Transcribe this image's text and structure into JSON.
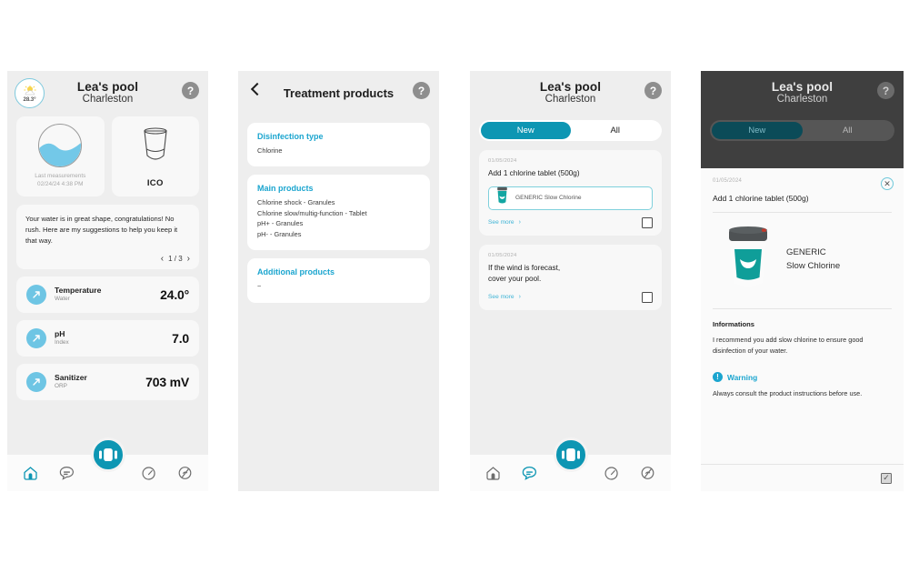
{
  "panel1": {
    "weather": {
      "temp": "28.3°",
      "icon": "sun-cloud-icon"
    },
    "header": {
      "title": "Lea's pool",
      "subtitle": "Charleston",
      "help": "?"
    },
    "tiles": [
      {
        "name": "water-measurements",
        "caption_line1": "Last measurements",
        "caption_line2": "02/24/24 4:38 PM"
      },
      {
        "name": "ico-device",
        "label": "ICO"
      }
    ],
    "advice": {
      "text": "Your water is in great shape, congratulations! No rush. Here are my suggestions to help you keep it that way.",
      "pager": "1 / 3",
      "prev": "‹",
      "next": "›"
    },
    "metrics": [
      {
        "name": "Temperature",
        "sub": "Water",
        "value": "24.0°"
      },
      {
        "name": "pH",
        "sub": "Index",
        "value": "7.0"
      },
      {
        "name": "Sanitizer",
        "sub": "ORP",
        "value": "703 mV"
      }
    ],
    "nav": [
      "home-icon",
      "chat-icon",
      "gauge-icon",
      "maintenance-icon"
    ],
    "active_nav": "home-icon"
  },
  "panel2": {
    "header": {
      "title": "Treatment products",
      "help": "?",
      "back": "back-arrow"
    },
    "sections": [
      {
        "title": "Disinfection type",
        "lines": [
          "Chlorine"
        ]
      },
      {
        "title": "Main products",
        "lines": [
          "Chlorine shock - Granules",
          "Chlorine slow/multig-function - Tablet",
          "pH+ - Granules",
          "pH- - Granules"
        ]
      },
      {
        "title": "Additional products",
        "lines": [
          "~"
        ]
      }
    ]
  },
  "panel3": {
    "header": {
      "title": "Lea's pool",
      "subtitle": "Charleston",
      "help": "?"
    },
    "tabs": [
      {
        "label": "New",
        "active": true
      },
      {
        "label": "All",
        "active": false
      }
    ],
    "messages": [
      {
        "date": "01/05/2024",
        "title": "Add 1 chlorine tablet (500g)",
        "product": "GENERIC Slow Chlorine",
        "see_more": "See more",
        "chevron": "›",
        "has_product": true
      },
      {
        "date": "01/05/2024",
        "title": "If the wind is forecast,\ncover your pool.",
        "see_more": "See more",
        "chevron": "›",
        "has_product": false
      }
    ],
    "nav": [
      "home-icon",
      "chat-icon",
      "gauge-icon",
      "maintenance-icon"
    ],
    "active_nav": "chat-icon"
  },
  "panel4": {
    "header": {
      "title": "Lea's pool",
      "subtitle": "Charleston",
      "help": "?"
    },
    "tabs": [
      {
        "label": "New",
        "active": true
      },
      {
        "label": "All",
        "active": false
      }
    ],
    "sheet": {
      "date": "01/05/2024",
      "title": "Add 1 chlorine tablet (500g)",
      "close": "✕",
      "product_brand": "GENERIC",
      "product_name": "Slow Chlorine",
      "info_heading": "Informations",
      "info_text": "I recommend you add slow chlorine to ensure good disinfection of your water.",
      "warning_badge": "!",
      "warning_title": "Warning",
      "warning_text": "Always consult the product instructions before use.",
      "confirm": "✓"
    }
  },
  "colors": {
    "accent_teal": "#0d96b3",
    "link_blue": "#1ba5cf",
    "metric_blue": "#6ec5e4",
    "panel_bg": "#eeeeee",
    "card_bg": "#f8f8f8",
    "dim_overlay": "#3f3f3f"
  }
}
